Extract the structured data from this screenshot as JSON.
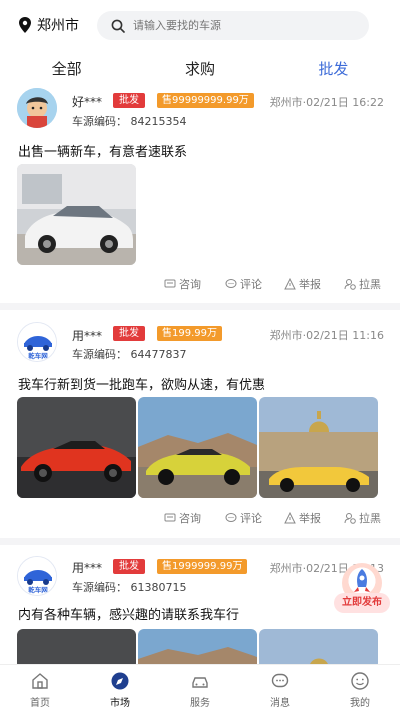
{
  "location": {
    "city": "郑州市"
  },
  "search": {
    "placeholder": "请输入要找的车源"
  },
  "tabs": [
    {
      "label": "全部",
      "active": false
    },
    {
      "label": "求购",
      "active": false
    },
    {
      "label": "批发",
      "active": true
    }
  ],
  "posts": [
    {
      "user": "好***",
      "tag": "批发",
      "price": "售99999999.99万",
      "location_time": "郑州市·02/21日 16:22",
      "code": "车源编码：  84215354",
      "desc": "出售一辆新车，有意者速联系",
      "actions": [
        "咨询",
        "评论",
        "举报",
        "拉黑"
      ]
    },
    {
      "user": "用***",
      "tag": "批发",
      "price": "售199.99万",
      "location_time": "郑州市·02/21日 11:16",
      "code": "车源编码：  64477837",
      "desc": "我车行新到货一批跑车，欲购从速，有优惠",
      "actions": [
        "咨询",
        "评论",
        "举报",
        "拉黑"
      ],
      "avatar_text": "乾车网"
    },
    {
      "user": "用***",
      "tag": "批发",
      "price": "售1999999.99万",
      "location_time": "郑州市·02/21日 11:13",
      "code": "车源编码：  61380715",
      "desc": "内有各种车辆，感兴趣的请联系我车行",
      "avatar_text": "乾车网"
    }
  ],
  "fab": {
    "label": "立即发布"
  },
  "bottom_nav": [
    {
      "label": "首页",
      "icon": "home-icon",
      "active": false
    },
    {
      "label": "市场",
      "icon": "compass-icon",
      "active": true
    },
    {
      "label": "服务",
      "icon": "car-icon",
      "active": false
    },
    {
      "label": "消息",
      "icon": "message-icon",
      "active": false
    },
    {
      "label": "我的",
      "icon": "user-icon",
      "active": false
    }
  ],
  "colors": {
    "accent": "#3c6bd8",
    "tag_red": "#e23b3b",
    "price_orange": "#f39a2b"
  }
}
